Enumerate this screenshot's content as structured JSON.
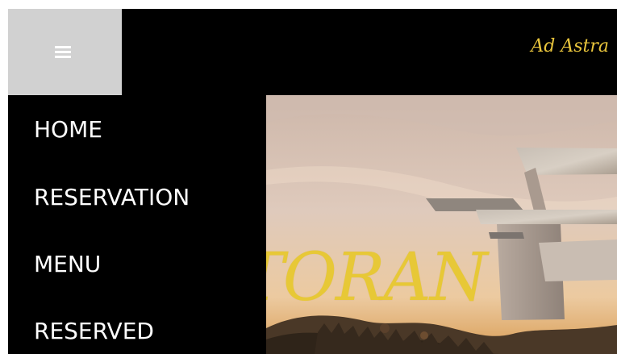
{
  "header": {
    "brand_text": "Ad Astra"
  },
  "hero": {
    "title_fragment": "TORAN"
  },
  "sidebar": {
    "items": [
      {
        "label": "HOME"
      },
      {
        "label": "RESERVATION"
      },
      {
        "label": "MENU"
      },
      {
        "label": "RESERVED"
      }
    ]
  },
  "icons": {
    "menu_toggle": "hamburger-icon"
  },
  "colors": {
    "topbar_bg": "#000000",
    "toggle_bg": "#d1d1d1",
    "brand_gold": "#e9c53c",
    "menu_text": "#ffffff"
  }
}
